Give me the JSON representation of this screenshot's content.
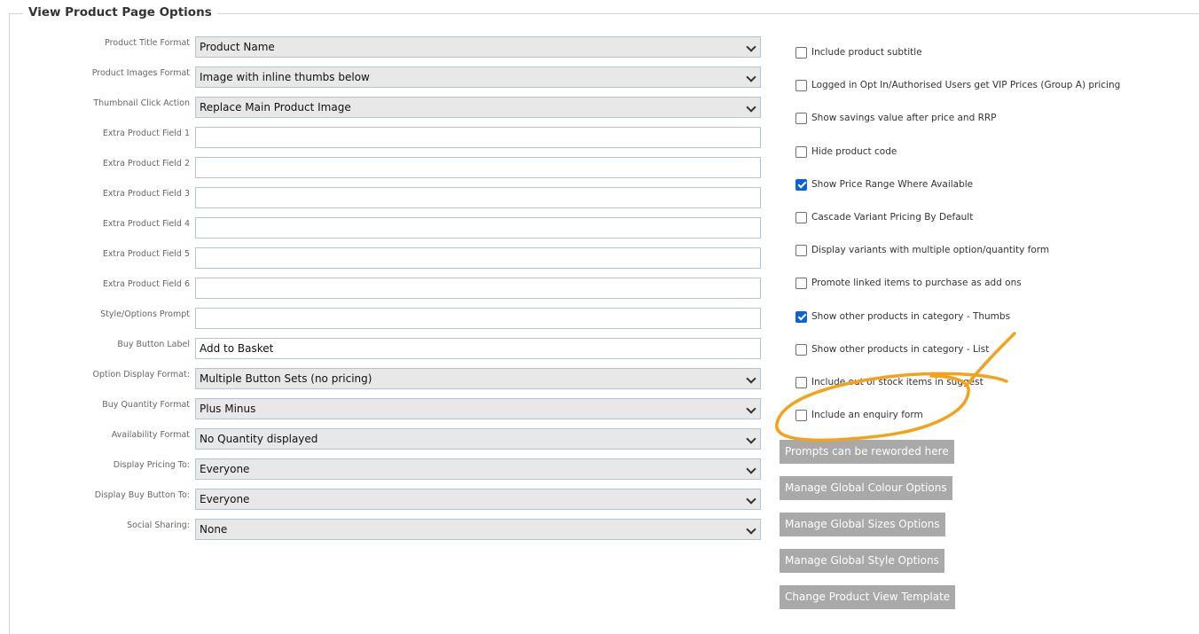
{
  "section": {
    "title": "View Product Page Options"
  },
  "form_rows": [
    {
      "label": "Product Title Format",
      "type": "select",
      "value": "Product Name"
    },
    {
      "label": "Product Images Format",
      "type": "select",
      "value": "Image with inline thumbs below"
    },
    {
      "label": "Thumbnail Click Action",
      "type": "select",
      "value": "Replace Main Product Image"
    },
    {
      "label": "Extra Product Field 1",
      "type": "input",
      "value": ""
    },
    {
      "label": "Extra Product Field 2",
      "type": "input",
      "value": ""
    },
    {
      "label": "Extra Product Field 3",
      "type": "input",
      "value": ""
    },
    {
      "label": "Extra Product Field 4",
      "type": "input",
      "value": ""
    },
    {
      "label": "Extra Product Field 5",
      "type": "input",
      "value": ""
    },
    {
      "label": "Extra Product Field 6",
      "type": "input",
      "value": ""
    },
    {
      "label": "Style/Options Prompt",
      "type": "input",
      "value": ""
    },
    {
      "label": "Buy Button Label",
      "type": "input",
      "value": "Add to Basket"
    },
    {
      "label": "Option Display Format:",
      "type": "select",
      "value": "Multiple Button Sets (no pricing)"
    },
    {
      "label": "Buy Quantity Format",
      "type": "select",
      "value": "Plus Minus"
    },
    {
      "label": "Availability Format",
      "type": "select",
      "value": "No Quantity displayed"
    },
    {
      "label": "Display Pricing To:",
      "type": "select",
      "value": "Everyone"
    },
    {
      "label": "Display Buy Button To:",
      "type": "select",
      "value": "Everyone"
    },
    {
      "label": "Social Sharing:",
      "type": "select",
      "value": "None"
    }
  ],
  "checkboxes": [
    {
      "label": "Include product subtitle",
      "checked": false
    },
    {
      "label": "Logged in Opt In/Authorised Users get VIP Prices (Group A) pricing",
      "checked": false
    },
    {
      "label": "Show savings value after price and RRP",
      "checked": false
    },
    {
      "label": "Hide product code",
      "checked": false
    },
    {
      "label": "Show Price Range Where Available",
      "checked": true
    },
    {
      "label": "Cascade Variant Pricing By Default",
      "checked": false
    },
    {
      "label": "Display variants with multiple option/quantity form",
      "checked": false
    },
    {
      "label": "Promote linked items to purchase as add ons",
      "checked": false
    },
    {
      "label": "Show other products in category - Thumbs",
      "checked": true
    },
    {
      "label": "Show other products in category - List",
      "checked": false
    },
    {
      "label": "Include out of stock items in suggest",
      "checked": false
    },
    {
      "label": "Include an enquiry form",
      "checked": false
    }
  ],
  "buttons": [
    {
      "label": "Prompts can be reworded here"
    },
    {
      "label": "Manage Global Colour Options"
    },
    {
      "label": "Manage Global Sizes Options"
    },
    {
      "label": "Manage Global Style Options"
    },
    {
      "label": "Change Product View Template"
    }
  ],
  "colors": {
    "annotation": "#f5a21b",
    "checkbox_checked": "#0a64d6",
    "button_bg": "#a9a9a9"
  },
  "icons": {
    "select_arrow": "chevron-down-icon",
    "check": "checkmark-icon"
  }
}
